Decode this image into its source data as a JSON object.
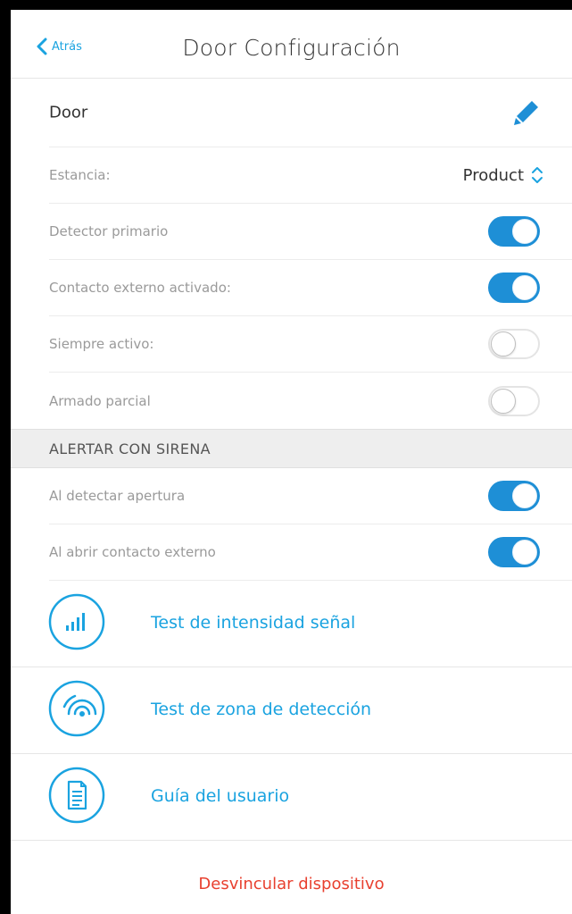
{
  "nav": {
    "back_label": "Atrás",
    "title": "Door Configuración"
  },
  "device": {
    "name": "Door",
    "room_label": "Estancia:",
    "room_value": "Product"
  },
  "settings": [
    {
      "label": "Detector primario",
      "on": true
    },
    {
      "label": "Contacto externo activado:",
      "on": true
    },
    {
      "label": "Siempre activo:",
      "on": false
    },
    {
      "label": "Armado parcial",
      "on": false
    }
  ],
  "siren_section": {
    "title": "ALERTAR CON SIRENA",
    "items": [
      {
        "label": "Al detectar apertura",
        "on": true
      },
      {
        "label": "Al abrir contacto externo",
        "on": true
      }
    ]
  },
  "actions": [
    {
      "label": "Test de intensidad señal",
      "icon": "signal-bars-icon"
    },
    {
      "label": "Test de zona de detección",
      "icon": "detection-zone-icon"
    },
    {
      "label": "Guía del usuario",
      "icon": "document-icon"
    }
  ],
  "unlink_label": "Desvincular dispositivo",
  "colors": {
    "accent": "#1aa3e0",
    "toggle_on": "#1e8fd6",
    "danger": "#e8402f"
  }
}
